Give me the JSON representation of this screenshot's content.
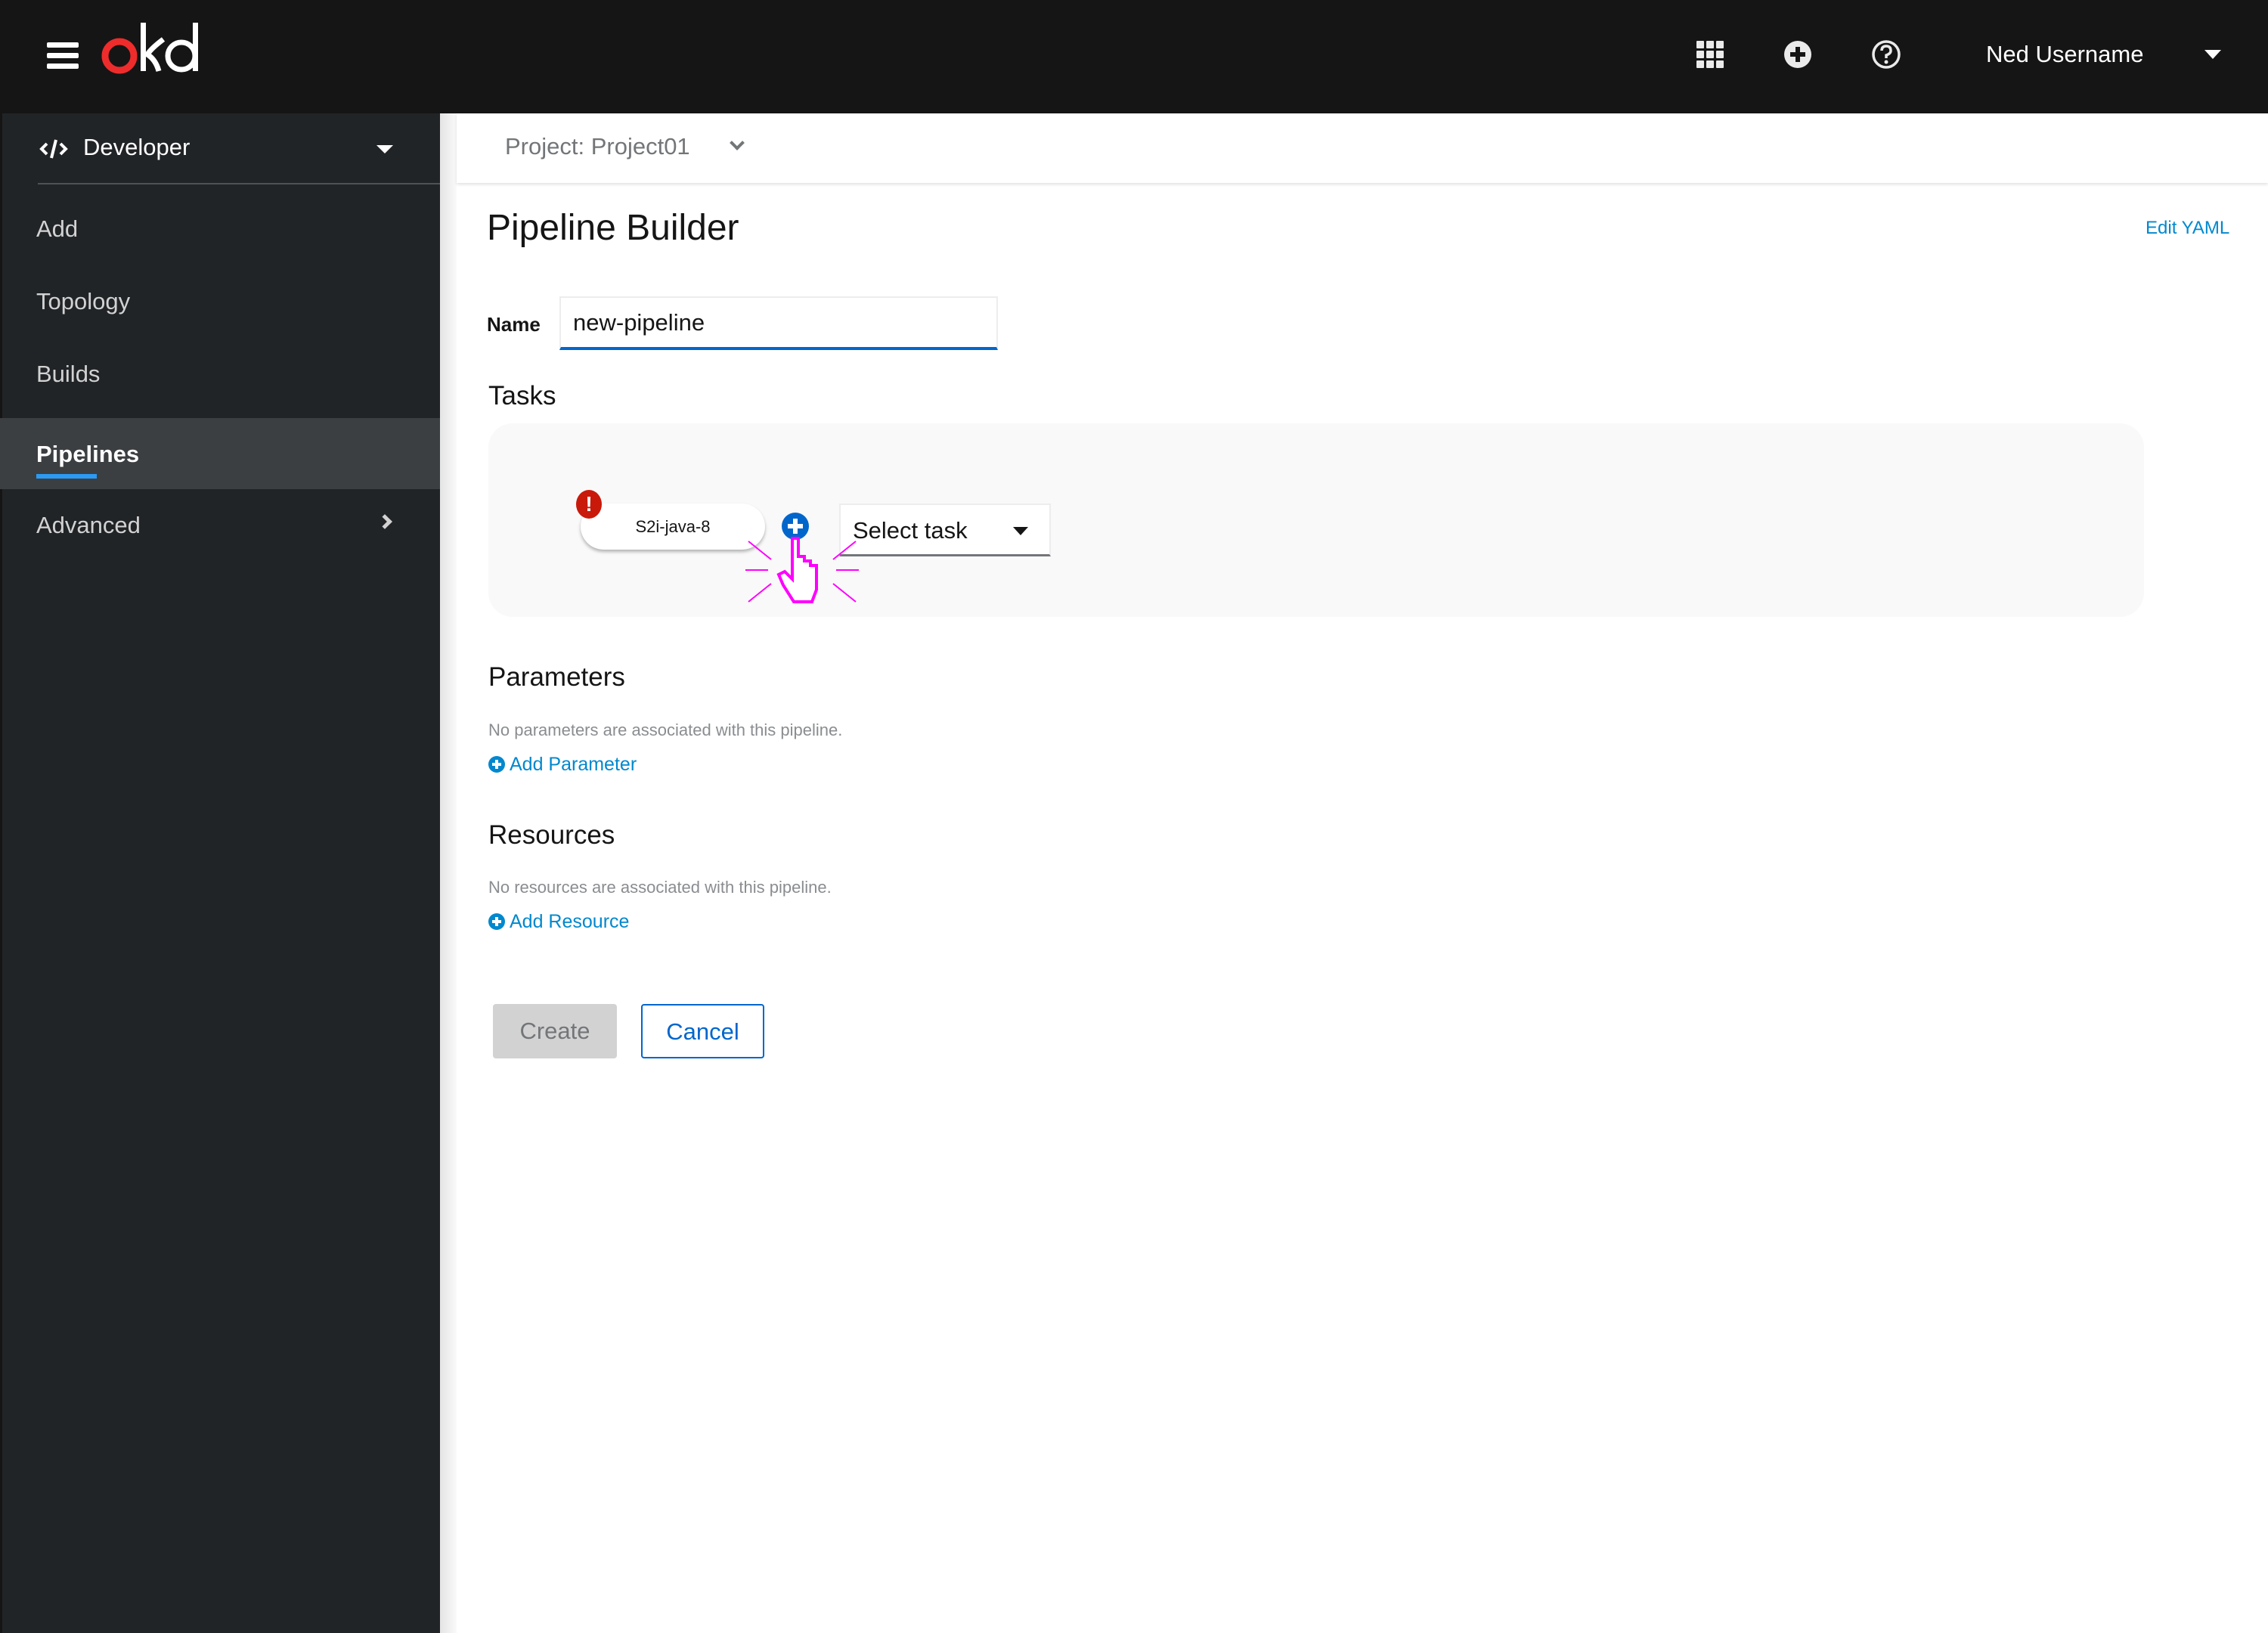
{
  "header": {
    "brand": {
      "first_letter": "o",
      "rest": "kd",
      "accent_color": "#ee2c2c"
    },
    "icons": [
      "menu-icon",
      "app-launcher-icon",
      "add-icon",
      "help-icon"
    ],
    "user": {
      "name": "Ned Username"
    }
  },
  "sidebar": {
    "perspective": {
      "label": "Developer",
      "icon": "code-icon"
    },
    "items": [
      {
        "label": "Add"
      },
      {
        "label": "Topology"
      },
      {
        "label": "Builds"
      },
      {
        "label": "Pipelines",
        "active": true
      },
      {
        "label": "Advanced",
        "expandable": true
      }
    ]
  },
  "project_bar": {
    "label": "Project:  Project01"
  },
  "page": {
    "title": "Pipeline Builder",
    "edit_yaml": "Edit YAML",
    "name_label": "Name",
    "name_value": "new-pipeline",
    "tasks": {
      "title": "Tasks",
      "nodes": [
        {
          "label": "S2i-java-8",
          "status": "error"
        }
      ],
      "error_badge": "!",
      "select_task": {
        "label": "Select task"
      }
    },
    "parameters": {
      "title": "Parameters",
      "empty": "No parameters are associated with this pipeline.",
      "add_label": "Add Parameter"
    },
    "resources": {
      "title": "Resources",
      "empty": "No resources are associated with this pipeline.",
      "add_label": "Add Resource"
    },
    "buttons": {
      "create": "Create",
      "cancel": "Cancel"
    }
  },
  "colors": {
    "header_bg": "#151515",
    "sidebar_bg": "#212427",
    "active_nav_bg": "#3c3f42",
    "active_underline": "#2b9af3",
    "primary_blue": "#0066cc",
    "link_blue": "#0088ce",
    "error_red": "#c9190b",
    "cursor_highlight": "#ff00ff"
  }
}
